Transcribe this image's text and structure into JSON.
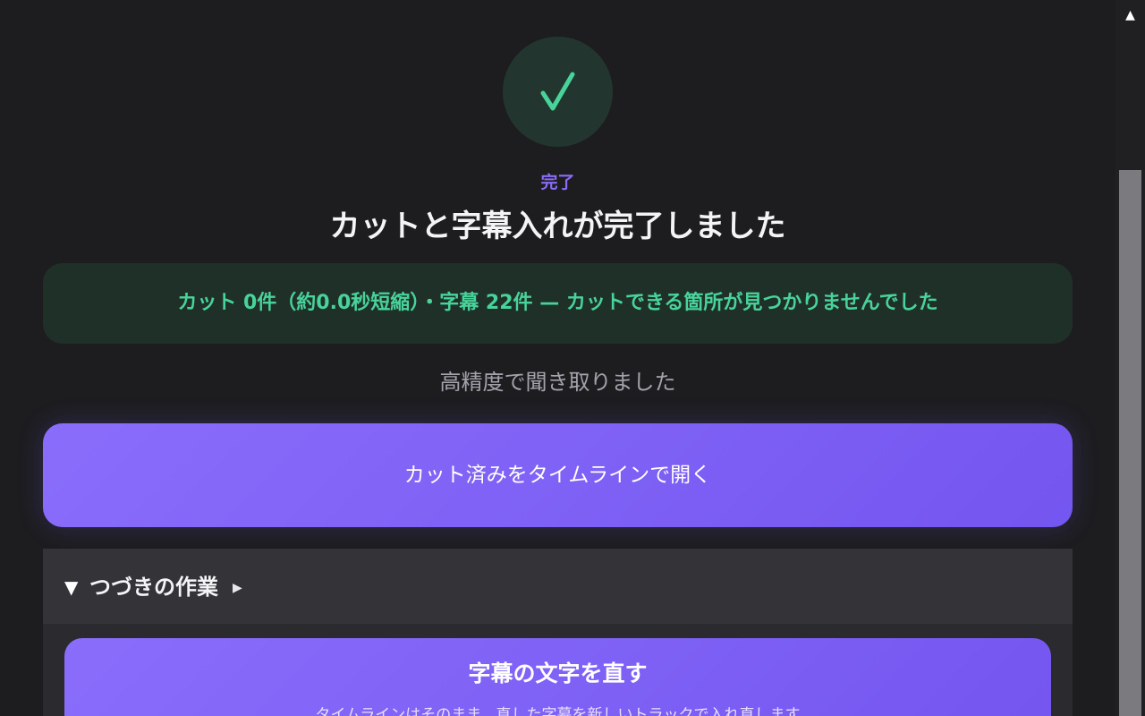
{
  "status": {
    "eyebrow": "完了",
    "title": "カットと字幕入れが完了しました",
    "result_message": "カット 0件（約0.0秒短縮）・字幕 22件 — カットできる箇所が見つかりませんでした",
    "accuracy_note": "高精度で聞き取りました",
    "success_color": "#48d39a",
    "accent_color": "#8b6cf6"
  },
  "actions": {
    "open_timeline_label": "カット済みをタイムラインで開く"
  },
  "next_steps": {
    "header_label": "つづきの作業",
    "toggle_icon": "triangle-down-icon",
    "hint_icon": "triangle-right-icon",
    "items": [
      {
        "title": "字幕の文字を直す",
        "description": "タイムラインはそのまま、直した字幕を新しいトラックで入れ直します"
      }
    ]
  },
  "icons": {
    "check": "check-icon",
    "scroll_up": "arrow-up-icon"
  }
}
